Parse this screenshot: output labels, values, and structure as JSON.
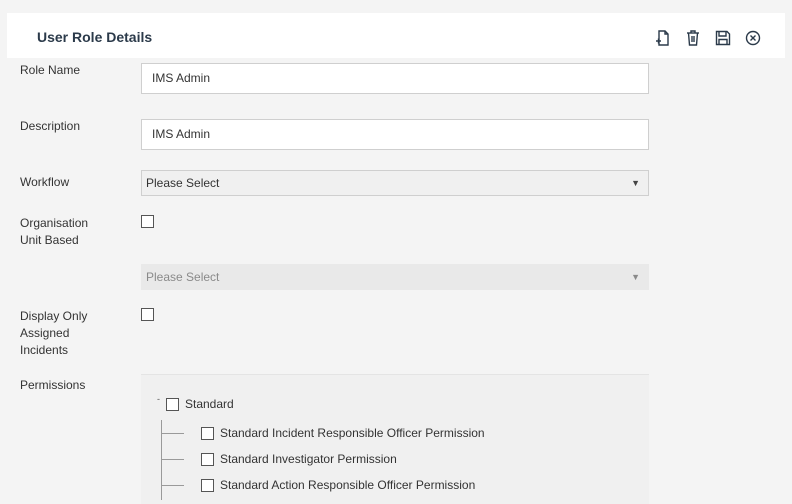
{
  "header": {
    "title": "User Role Details",
    "toolbar": [
      {
        "name": "new-document-icon",
        "label": "New"
      },
      {
        "name": "delete-icon",
        "label": "Delete"
      },
      {
        "name": "save-icon",
        "label": "Save"
      },
      {
        "name": "close-icon",
        "label": "Close"
      }
    ]
  },
  "form": {
    "role_name_label": "Role Name",
    "role_name_value": "IMS Admin",
    "description_label": "Description",
    "description_value": "IMS Admin",
    "workflow_label": "Workflow",
    "workflow_value": "Please Select",
    "org_unit_label_line1": "Organisation",
    "org_unit_label_line2": "Unit Based",
    "org_unit_checked": false,
    "org_unit_select_value": "Please Select",
    "display_only_label_line1": "Display Only",
    "display_only_label_line2": "Assigned",
    "display_only_label_line3": "Incidents",
    "display_only_checked": false,
    "permissions_label": "Permissions"
  },
  "permissions": {
    "root": {
      "label": "Standard",
      "toggle": "-",
      "checked": false
    },
    "children": [
      {
        "label": "Standard Incident Responsible Officer Permission",
        "checked": false
      },
      {
        "label": "Standard Investigator Permission",
        "checked": false
      },
      {
        "label": "Standard Action Responsible Officer Permission",
        "checked": false
      }
    ]
  },
  "icons": {
    "select_arrow": "▼"
  }
}
